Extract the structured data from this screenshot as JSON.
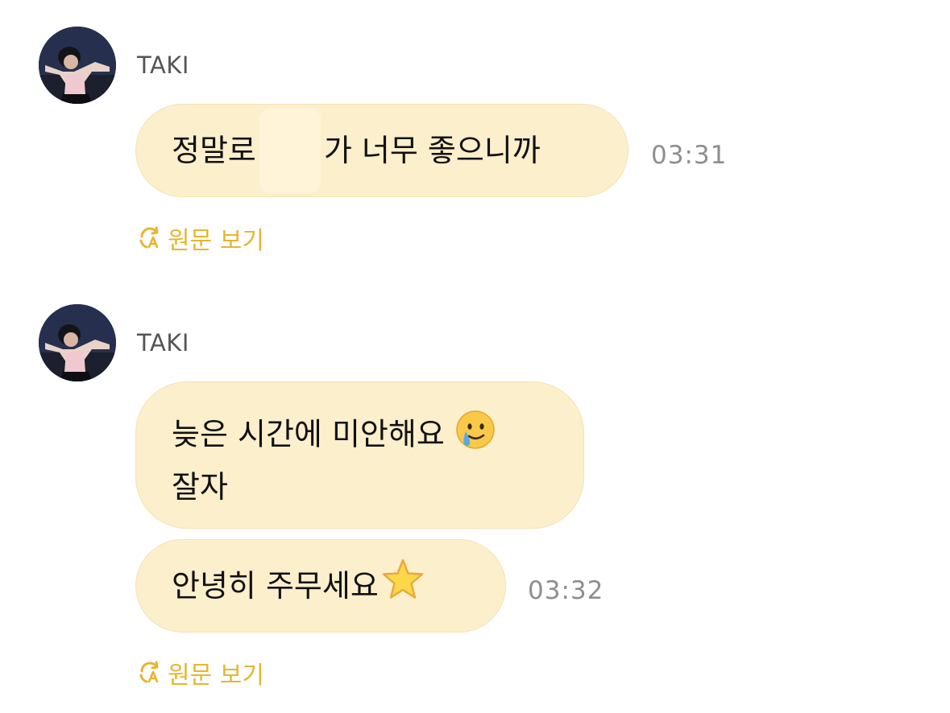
{
  "messages": [
    {
      "sender": "TAKI",
      "bubbles": [
        {
          "part1": "정말로",
          "part2": "가 너무 좋으니까"
        }
      ],
      "time": "03:31",
      "view_original": "원문 보기"
    },
    {
      "sender": "TAKI",
      "bubbles": [
        {
          "line1": "늦은 시간에 미안해요",
          "line2": "잘자",
          "emoji": "crying-smile-emoji"
        },
        {
          "text": "안녕히 주무세요",
          "emoji": "star-emoji"
        }
      ],
      "time": "03:32",
      "view_original": "원문 보기"
    }
  ],
  "colors": {
    "bubble": "#fcefcc",
    "accent": "#e7b52f",
    "time": "#8e8e8e",
    "sender": "#555555"
  }
}
